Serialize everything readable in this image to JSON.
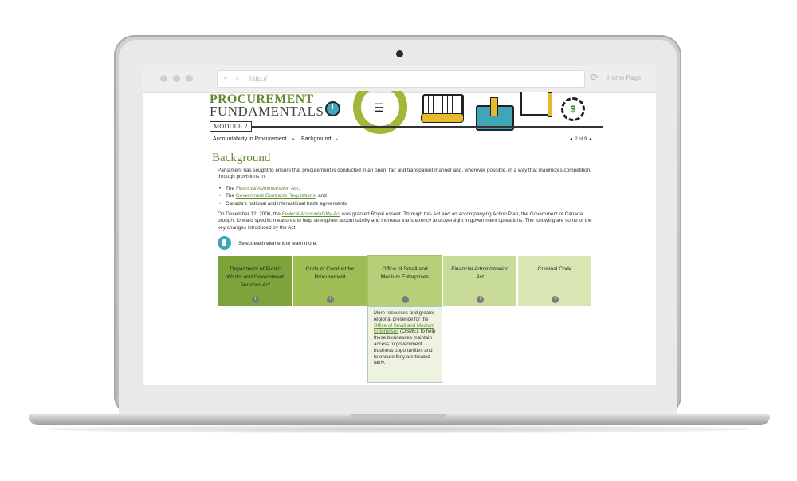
{
  "browser": {
    "url": "http://",
    "home_label": "Home Page",
    "nav_arrows": "‹ ›",
    "reload_icon": "⟳"
  },
  "course": {
    "title_line1": "PROCUREMENT",
    "title_line2": "FUNDAMENTALS",
    "module_label": "MODULE 2",
    "gear_symbol": "$"
  },
  "breadcrumb": {
    "items": [
      "Accountability in Procurement",
      "Background"
    ],
    "separator": "▸",
    "pager_prev": "◂",
    "pager_text": "2 of 9",
    "pager_next": "▸"
  },
  "content": {
    "heading": "Background",
    "intro": "Parliament has sought to ensure that procurement is conducted in an open, fair and transparent manner and, wherever possible, in a way that maximizes competition, through provisions in:",
    "list": [
      {
        "prefix": "The ",
        "link": "Financial Administration Act",
        "suffix": ";"
      },
      {
        "prefix": "The ",
        "link": "Government Contracts Regulations",
        "suffix": "; and"
      },
      {
        "prefix": "",
        "link": "",
        "suffix": "Canada's national and international trade agreements."
      }
    ],
    "para2_a": "On December 12, 2006, the ",
    "para2_link": "Federal Accountability Act",
    "para2_b": " was granted Royal Assent. Through this Act and an accompanying Action Plan, the Government of Canada brought forward specific measures to help strengthen accountability and increase transparency and oversight in government operations. The following are some of the key changes introduced by the Act:",
    "instruction": "Select each element to learn more."
  },
  "tabs": [
    {
      "label": "Department of Public Works and Government Services Act",
      "italic": true,
      "button": "+"
    },
    {
      "label": "Code of Conduct for Procurement",
      "italic": false,
      "button": "+"
    },
    {
      "label": "Office of Small and Medium Enterprises",
      "italic": false,
      "button": "−"
    },
    {
      "label": "Financial Administration Act",
      "italic": true,
      "button": "+"
    },
    {
      "label": "Criminal Code",
      "italic": false,
      "button": "+"
    }
  ],
  "panel": {
    "text_a": "More resources and greater regional presence for the ",
    "link": "Office of Small and Medium Enterprises",
    "text_b": " (OSME), to help these businesses maintain access to government business opportunities and to ensure they are treated fairly."
  },
  "colors": {
    "brand_green": "#5e8a2f",
    "accent_teal": "#3ea6b6",
    "accent_yellow": "#e8b92a"
  }
}
